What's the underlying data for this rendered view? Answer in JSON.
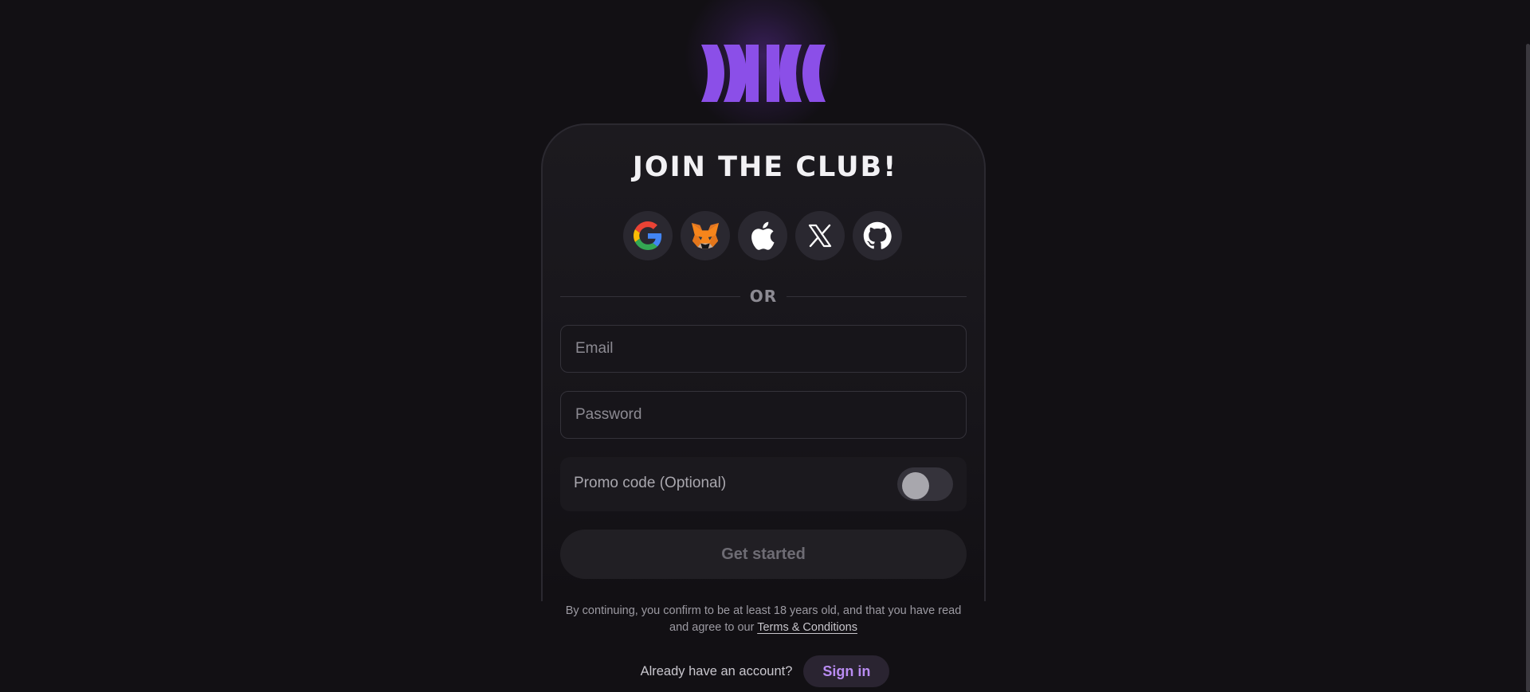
{
  "colors": {
    "background": "#121014",
    "brand": "#8b4fe8",
    "card": "#1c1a1f",
    "link_accent": "#b98cf2"
  },
  "header": {
    "logo_icon": "club-logo-icon"
  },
  "title": "JOIN THE CLUB!",
  "social": [
    {
      "icon": "google-icon"
    },
    {
      "icon": "metamask-fox-icon"
    },
    {
      "icon": "apple-icon"
    },
    {
      "icon": "x-icon"
    },
    {
      "icon": "github-icon"
    }
  ],
  "divider_text": "OR",
  "form": {
    "email_placeholder": "Email",
    "email_value": "",
    "password_placeholder": "Password",
    "password_value": "",
    "promo_label": "Promo code (Optional)",
    "promo_enabled": false,
    "submit_label": "Get started"
  },
  "legal": {
    "text": "By continuing, you confirm to be at least 18 years old, and that you have read and agree to our",
    "link_label": "Terms & Conditions"
  },
  "signin": {
    "question": "Already have an account?",
    "button_label": "Sign in"
  }
}
